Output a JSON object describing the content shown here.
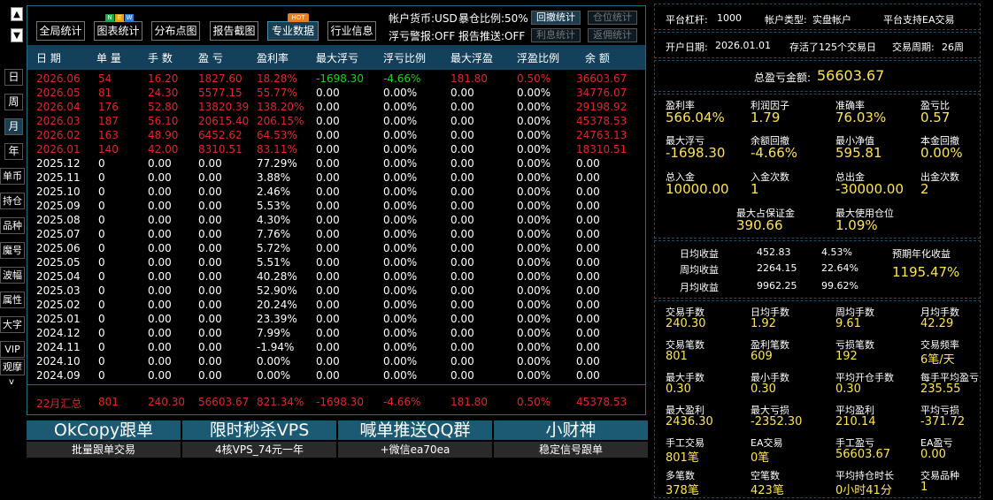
{
  "sidebar": {
    "up": "▲",
    "down": "▼",
    "period": [
      "日",
      "周",
      "月",
      "年"
    ],
    "buttons": [
      "单币",
      "持仓",
      "品种",
      "魔号",
      "波幅",
      "属性",
      "大字",
      "VIP",
      "观摩"
    ],
    "more": "v"
  },
  "toolbar": {
    "buttons": [
      "全局统计",
      "图表统计",
      "分布点图",
      "报告截图",
      "专业数据",
      "行业信息"
    ],
    "new_badge": [
      "N",
      "E",
      "W"
    ],
    "hot_badge": "HOT"
  },
  "info": {
    "currency": "帐户货币:USD",
    "exposure": "暴仓比例:50%",
    "float_alert": "浮亏警报:OFF",
    "report_push": "报告推送:OFF",
    "buttons": [
      "回撤统计",
      "仓位统计",
      "利息统计",
      "返佣统计"
    ]
  },
  "table": {
    "headers": [
      "日 期",
      "单 量",
      "手 数",
      "盈 亏",
      "盈利率",
      "最大浮亏",
      "浮亏比例",
      "最大浮盈",
      "浮盈比例",
      "余 额"
    ],
    "rows": [
      [
        "2026.06",
        "54",
        "16.20",
        "1827.60",
        "18.28%",
        "-1698.30",
        "-4.66%",
        "181.80",
        "0.50%",
        "36603.67"
      ],
      [
        "2026.05",
        "81",
        "24.30",
        "5577.15",
        "55.77%",
        "0.00",
        "0.00%",
        "0.00",
        "0.00%",
        "34776.07"
      ],
      [
        "2026.04",
        "176",
        "52.80",
        "13820.39",
        "138.20%",
        "0.00",
        "0.00%",
        "0.00",
        "0.00%",
        "29198.92"
      ],
      [
        "2026.03",
        "187",
        "56.10",
        "20615.40",
        "206.15%",
        "0.00",
        "0.00%",
        "0.00",
        "0.00%",
        "45378.53"
      ],
      [
        "2026.02",
        "163",
        "48.90",
        "6452.62",
        "64.53%",
        "0.00",
        "0.00%",
        "0.00",
        "0.00%",
        "24763.13"
      ],
      [
        "2026.01",
        "140",
        "42.00",
        "8310.51",
        "83.11%",
        "0.00",
        "0.00%",
        "0.00",
        "0.00%",
        "18310.51"
      ],
      [
        "2025.12",
        "0",
        "0.00",
        "0.00",
        "77.29%",
        "0.00",
        "0.00%",
        "0.00",
        "0.00%",
        "0.00"
      ],
      [
        "2025.11",
        "0",
        "0.00",
        "0.00",
        "3.88%",
        "0.00",
        "0.00%",
        "0.00",
        "0.00%",
        "0.00"
      ],
      [
        "2025.10",
        "0",
        "0.00",
        "0.00",
        "2.46%",
        "0.00",
        "0.00%",
        "0.00",
        "0.00%",
        "0.00"
      ],
      [
        "2025.09",
        "0",
        "0.00",
        "0.00",
        "5.53%",
        "0.00",
        "0.00%",
        "0.00",
        "0.00%",
        "0.00"
      ],
      [
        "2025.08",
        "0",
        "0.00",
        "0.00",
        "4.30%",
        "0.00",
        "0.00%",
        "0.00",
        "0.00%",
        "0.00"
      ],
      [
        "2025.07",
        "0",
        "0.00",
        "0.00",
        "7.76%",
        "0.00",
        "0.00%",
        "0.00",
        "0.00%",
        "0.00"
      ],
      [
        "2025.06",
        "0",
        "0.00",
        "0.00",
        "5.72%",
        "0.00",
        "0.00%",
        "0.00",
        "0.00%",
        "0.00"
      ],
      [
        "2025.05",
        "0",
        "0.00",
        "0.00",
        "5.51%",
        "0.00",
        "0.00%",
        "0.00",
        "0.00%",
        "0.00"
      ],
      [
        "2025.04",
        "0",
        "0.00",
        "0.00",
        "40.28%",
        "0.00",
        "0.00%",
        "0.00",
        "0.00%",
        "0.00"
      ],
      [
        "2025.03",
        "0",
        "0.00",
        "0.00",
        "52.90%",
        "0.00",
        "0.00%",
        "0.00",
        "0.00%",
        "0.00"
      ],
      [
        "2025.02",
        "0",
        "0.00",
        "0.00",
        "20.24%",
        "0.00",
        "0.00%",
        "0.00",
        "0.00%",
        "0.00"
      ],
      [
        "2025.01",
        "0",
        "0.00",
        "0.00",
        "23.39%",
        "0.00",
        "0.00%",
        "0.00",
        "0.00%",
        "0.00"
      ],
      [
        "2024.12",
        "0",
        "0.00",
        "0.00",
        "7.99%",
        "0.00",
        "0.00%",
        "0.00",
        "0.00%",
        "0.00"
      ],
      [
        "2024.11",
        "0",
        "0.00",
        "0.00",
        "-1.94%",
        "0.00",
        "0.00%",
        "0.00",
        "0.00%",
        "0.00"
      ],
      [
        "2024.10",
        "0",
        "0.00",
        "0.00",
        "0.00%",
        "0.00",
        "0.00%",
        "0.00",
        "0.00%",
        "0.00"
      ],
      [
        "2024.09",
        "0",
        "0.00",
        "0.00",
        "0.00%",
        "0.00",
        "0.00%",
        "0.00",
        "0.00%",
        "0.00"
      ]
    ],
    "summary": [
      "22月汇总",
      "801",
      "240.30",
      "56603.67",
      "821.34%",
      "-1698.30",
      "-4.66%",
      "181.80",
      "0.50%",
      "45378.53"
    ]
  },
  "promos": [
    {
      "title": "OkCopy跟单",
      "sub": "批量跟单交易"
    },
    {
      "title": "限时秒杀VPS",
      "sub": "4核VPS_74元一年"
    },
    {
      "title": "喊单推送QQ群",
      "sub": "+微信ea70ea"
    },
    {
      "title": "小财神",
      "sub": "稳定信号跟单"
    }
  ],
  "right": {
    "header1": [
      "平台杠杆:",
      "1000",
      "帐户类型:",
      "实盘帐户",
      "平台支持EA交易"
    ],
    "header2": [
      "开户日期:",
      "2026.01.01",
      "存活了125个交易日",
      "交易周期:",
      "26周"
    ],
    "total_label": "总盈亏金额:",
    "total_value": "56603.67",
    "stats1": [
      {
        "label": "盈利率",
        "value": "566.04%"
      },
      {
        "label": "利润因子",
        "value": "1.79"
      },
      {
        "label": "准确率",
        "value": "76.03%"
      },
      {
        "label": "盈亏比",
        "value": "0.57"
      },
      {
        "label": "最大浮亏",
        "value": "-1698.30"
      },
      {
        "label": "余额回撤",
        "value": "-4.66%"
      },
      {
        "label": "最小净值",
        "value": "595.81"
      },
      {
        "label": "本金回撤",
        "value": "0.00%"
      },
      {
        "label": "总入金",
        "value": "10000.00"
      },
      {
        "label": "入金次数",
        "value": "1"
      },
      {
        "label": "总出金",
        "value": "-30000.00"
      },
      {
        "label": "出金次数",
        "value": "2"
      },
      {
        "label": "最大占保证金",
        "value": "390.66"
      },
      {
        "label": "最大使用仓位",
        "value": "1.09%"
      }
    ],
    "daily": [
      {
        "label": "日均收益",
        "amount": "452.83",
        "pct": "4.53%"
      },
      {
        "label": "周均收益",
        "amount": "2264.15",
        "pct": "22.64%"
      },
      {
        "label": "月均收益",
        "amount": "9962.25",
        "pct": "99.62%"
      }
    ],
    "annual_label": "预期年化收益",
    "annual_value": "1195.47%",
    "stats2": [
      {
        "label": "交易手数",
        "value": "240.30"
      },
      {
        "label": "日均手数",
        "value": "1.92"
      },
      {
        "label": "周均手数",
        "value": "9.61"
      },
      {
        "label": "月均手数",
        "value": "42.29"
      },
      {
        "label": "交易笔数",
        "value": "801"
      },
      {
        "label": "盈利笔数",
        "value": "609"
      },
      {
        "label": "亏损笔数",
        "value": "192"
      },
      {
        "label": "交易频率",
        "value": "6笔/天"
      },
      {
        "label": "最大手数",
        "value": "0.30"
      },
      {
        "label": "最小手数",
        "value": "0.30"
      },
      {
        "label": "平均开仓手数",
        "value": "0.30"
      },
      {
        "label": "每手平均盈亏",
        "value": "235.55"
      },
      {
        "label": "最大盈利",
        "value": "2436.30"
      },
      {
        "label": "最大亏损",
        "value": "-2352.30"
      },
      {
        "label": "平均盈利",
        "value": "210.14"
      },
      {
        "label": "平均亏损",
        "value": "-371.72"
      },
      {
        "label": "手工交易",
        "value": "801笔"
      },
      {
        "label": "EA交易",
        "value": "0笔"
      },
      {
        "label": "手工盈亏",
        "value": "56603.67"
      },
      {
        "label": "EA盈亏",
        "value": "0.00"
      },
      {
        "label": "多笔数",
        "value": "378笔"
      },
      {
        "label": "空笔数",
        "value": "423笔"
      },
      {
        "label": "平均持仓时长",
        "value": "0小时41分"
      },
      {
        "label": "交易品种",
        "value": "1"
      }
    ]
  }
}
